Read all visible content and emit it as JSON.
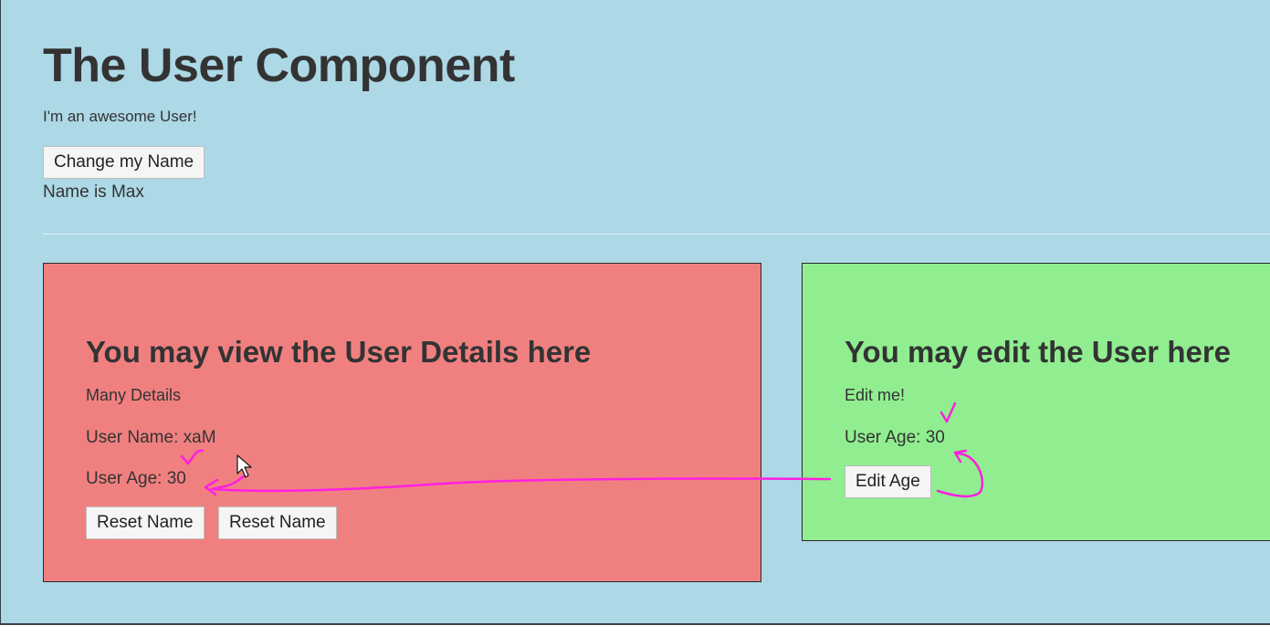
{
  "user_component": {
    "title": "The User Component",
    "intro": "I'm an awesome User!",
    "change_name_label": "Change my Name",
    "name_line": "Name is Max"
  },
  "user_detail": {
    "title": "You may view the User Details here",
    "subtitle": "Many Details",
    "user_name_line": "User Name: xaM",
    "user_age_line": "User Age: 30",
    "reset_buttons": [
      "Reset Name",
      "Reset Name"
    ]
  },
  "user_edit": {
    "title": "You may edit the User here",
    "subtitle": "Edit me!",
    "user_age_line": "User Age: 30",
    "edit_age_label": "Edit Age"
  },
  "colors": {
    "page_background": "#add8e6",
    "detail_panel": "#f08080",
    "edit_panel": "#90ee90",
    "annotation": "#ff1fe0"
  },
  "icons": {
    "cursor": "mouse-pointer-icon",
    "annotation_marks": [
      "check-mark-icon",
      "check-mark-icon",
      "arrow-annotation-icon",
      "loop-arrow-annotation-icon"
    ]
  }
}
